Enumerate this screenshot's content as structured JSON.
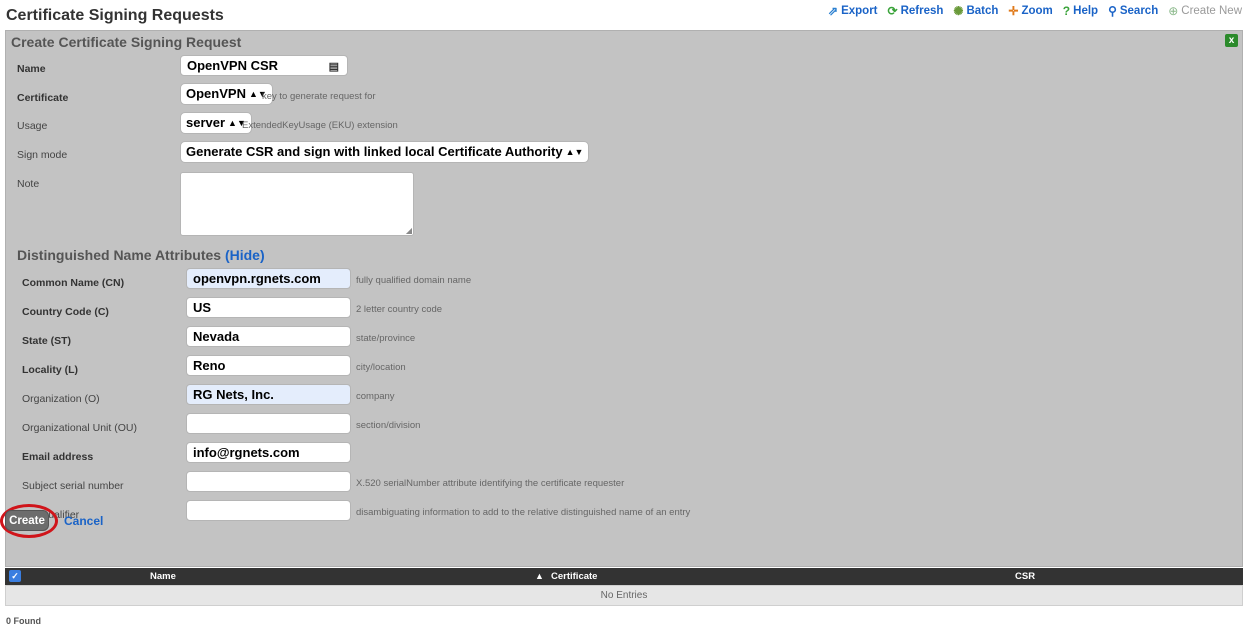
{
  "page": {
    "title": "Certificate Signing Requests"
  },
  "toolbar": {
    "export": "Export",
    "refresh": "Refresh",
    "batch": "Batch",
    "zoom": "Zoom",
    "help": "Help",
    "search": "Search",
    "create_new": "Create New"
  },
  "form": {
    "title": "Create Certificate Signing Request",
    "close": "x",
    "name": {
      "label": "Name",
      "value": "OpenVPN CSR"
    },
    "certificate": {
      "label": "Certificate",
      "value": "OpenVPN",
      "hint": "key to generate request for"
    },
    "usage": {
      "label": "Usage",
      "value": "server",
      "hint": "ExtendedKeyUsage (EKU) extension"
    },
    "sign_mode": {
      "label": "Sign mode",
      "value": "Generate CSR and sign with linked local Certificate Authority"
    },
    "note": {
      "label": "Note",
      "value": ""
    }
  },
  "dn": {
    "title": "Distinguished Name Attributes",
    "hide_link": "(Hide)",
    "fields": [
      {
        "label": "Common Name (CN)",
        "value": "openvpn.rgnets.com",
        "hint": "fully qualified domain name"
      },
      {
        "label": "Country Code (C)",
        "value": "US",
        "hint": "2 letter country code"
      },
      {
        "label": "State (ST)",
        "value": "Nevada",
        "hint": "state/province"
      },
      {
        "label": "Locality (L)",
        "value": "Reno",
        "hint": "city/location"
      },
      {
        "label": "Organization (O)",
        "value": "RG Nets, Inc.",
        "hint": "company"
      },
      {
        "label": "Organizational Unit (OU)",
        "value": "",
        "hint": "section/division"
      },
      {
        "label": "Email address",
        "value": "info@rgnets.com",
        "hint": ""
      },
      {
        "label": "Subject serial number",
        "value": "",
        "hint": "X.520 serialNumber attribute identifying the certificate requester"
      },
      {
        "label": "DN Qualifier",
        "value": "",
        "hint": "disambiguating information to add to the relative distinguished name of an entry"
      }
    ]
  },
  "actions": {
    "create": "Create",
    "cancel": "Cancel"
  },
  "table": {
    "columns": [
      "Name",
      "Certificate",
      "CSR"
    ],
    "sort_indicator": "▲",
    "empty": "No Entries",
    "found": "0 Found"
  },
  "colors": {
    "accent": "#1a63c7",
    "panel": "#c3c3c3",
    "highlight": "#d0141a"
  }
}
